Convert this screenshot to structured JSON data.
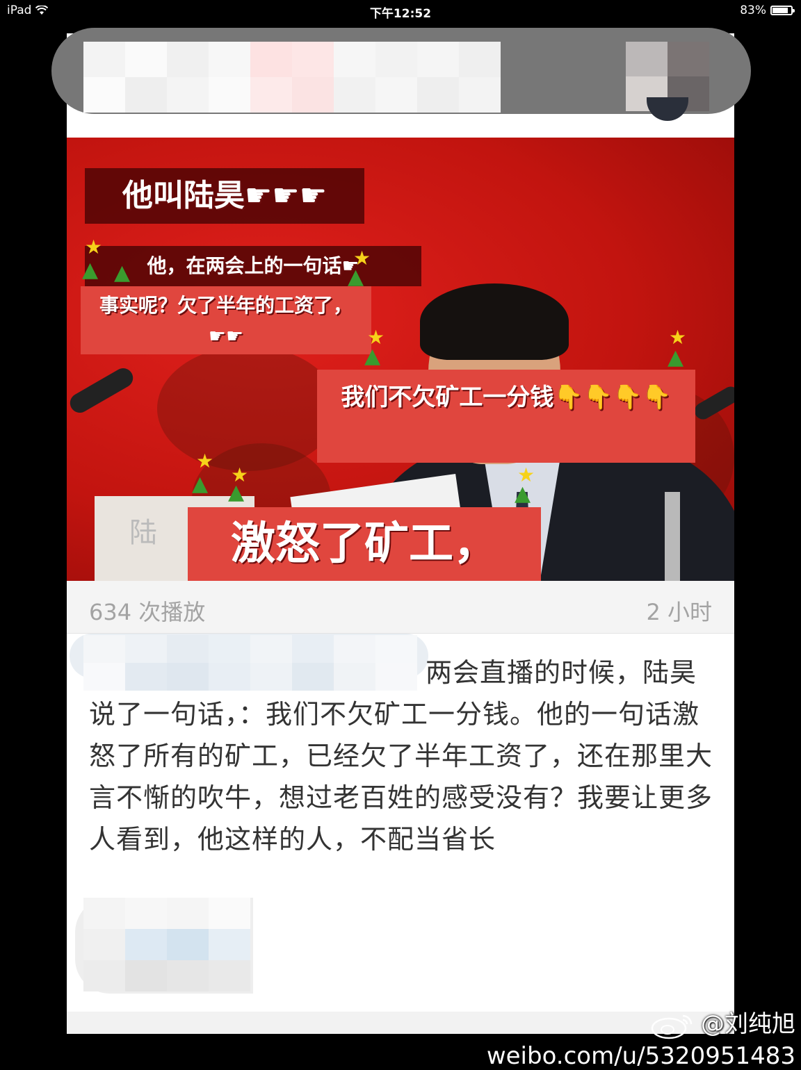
{
  "status_bar": {
    "device": "iPad",
    "time": "下午12:52",
    "battery": "83%",
    "battery_level": 0.83
  },
  "media": {
    "nameplate_char": "陆",
    "captions": [
      "他叫陆昊☛☛☛",
      "他，在两会上的一句话☛",
      "事实呢？欠了半年的工资了，☛☛",
      "我们不欠矿工一分钱👇👇👇👇",
      "激怒了矿工，"
    ]
  },
  "meta": {
    "plays": "634 次播放",
    "time_ago": "2 小时"
  },
  "post": {
    "text": "两会直播的时候，陆昊说了一句话，：我们不欠矿工一分钱。他的一句话激怒了所有的矿工，已经欠了半年工资了，还在那里大言不惭的吹牛，想过老百姓的感受没有？我要让更多人看到，他这样的人，不配当省长"
  },
  "watermark": {
    "handle": "@刘纯旭",
    "url": "weibo.com/u/5320951483"
  },
  "colors": {
    "background": "#000000",
    "card": "#ffffff",
    "media_red": "#c2140f",
    "caption_box": "#e0463e",
    "meta_text": "#a3a3a3",
    "post_text": "#333333"
  }
}
